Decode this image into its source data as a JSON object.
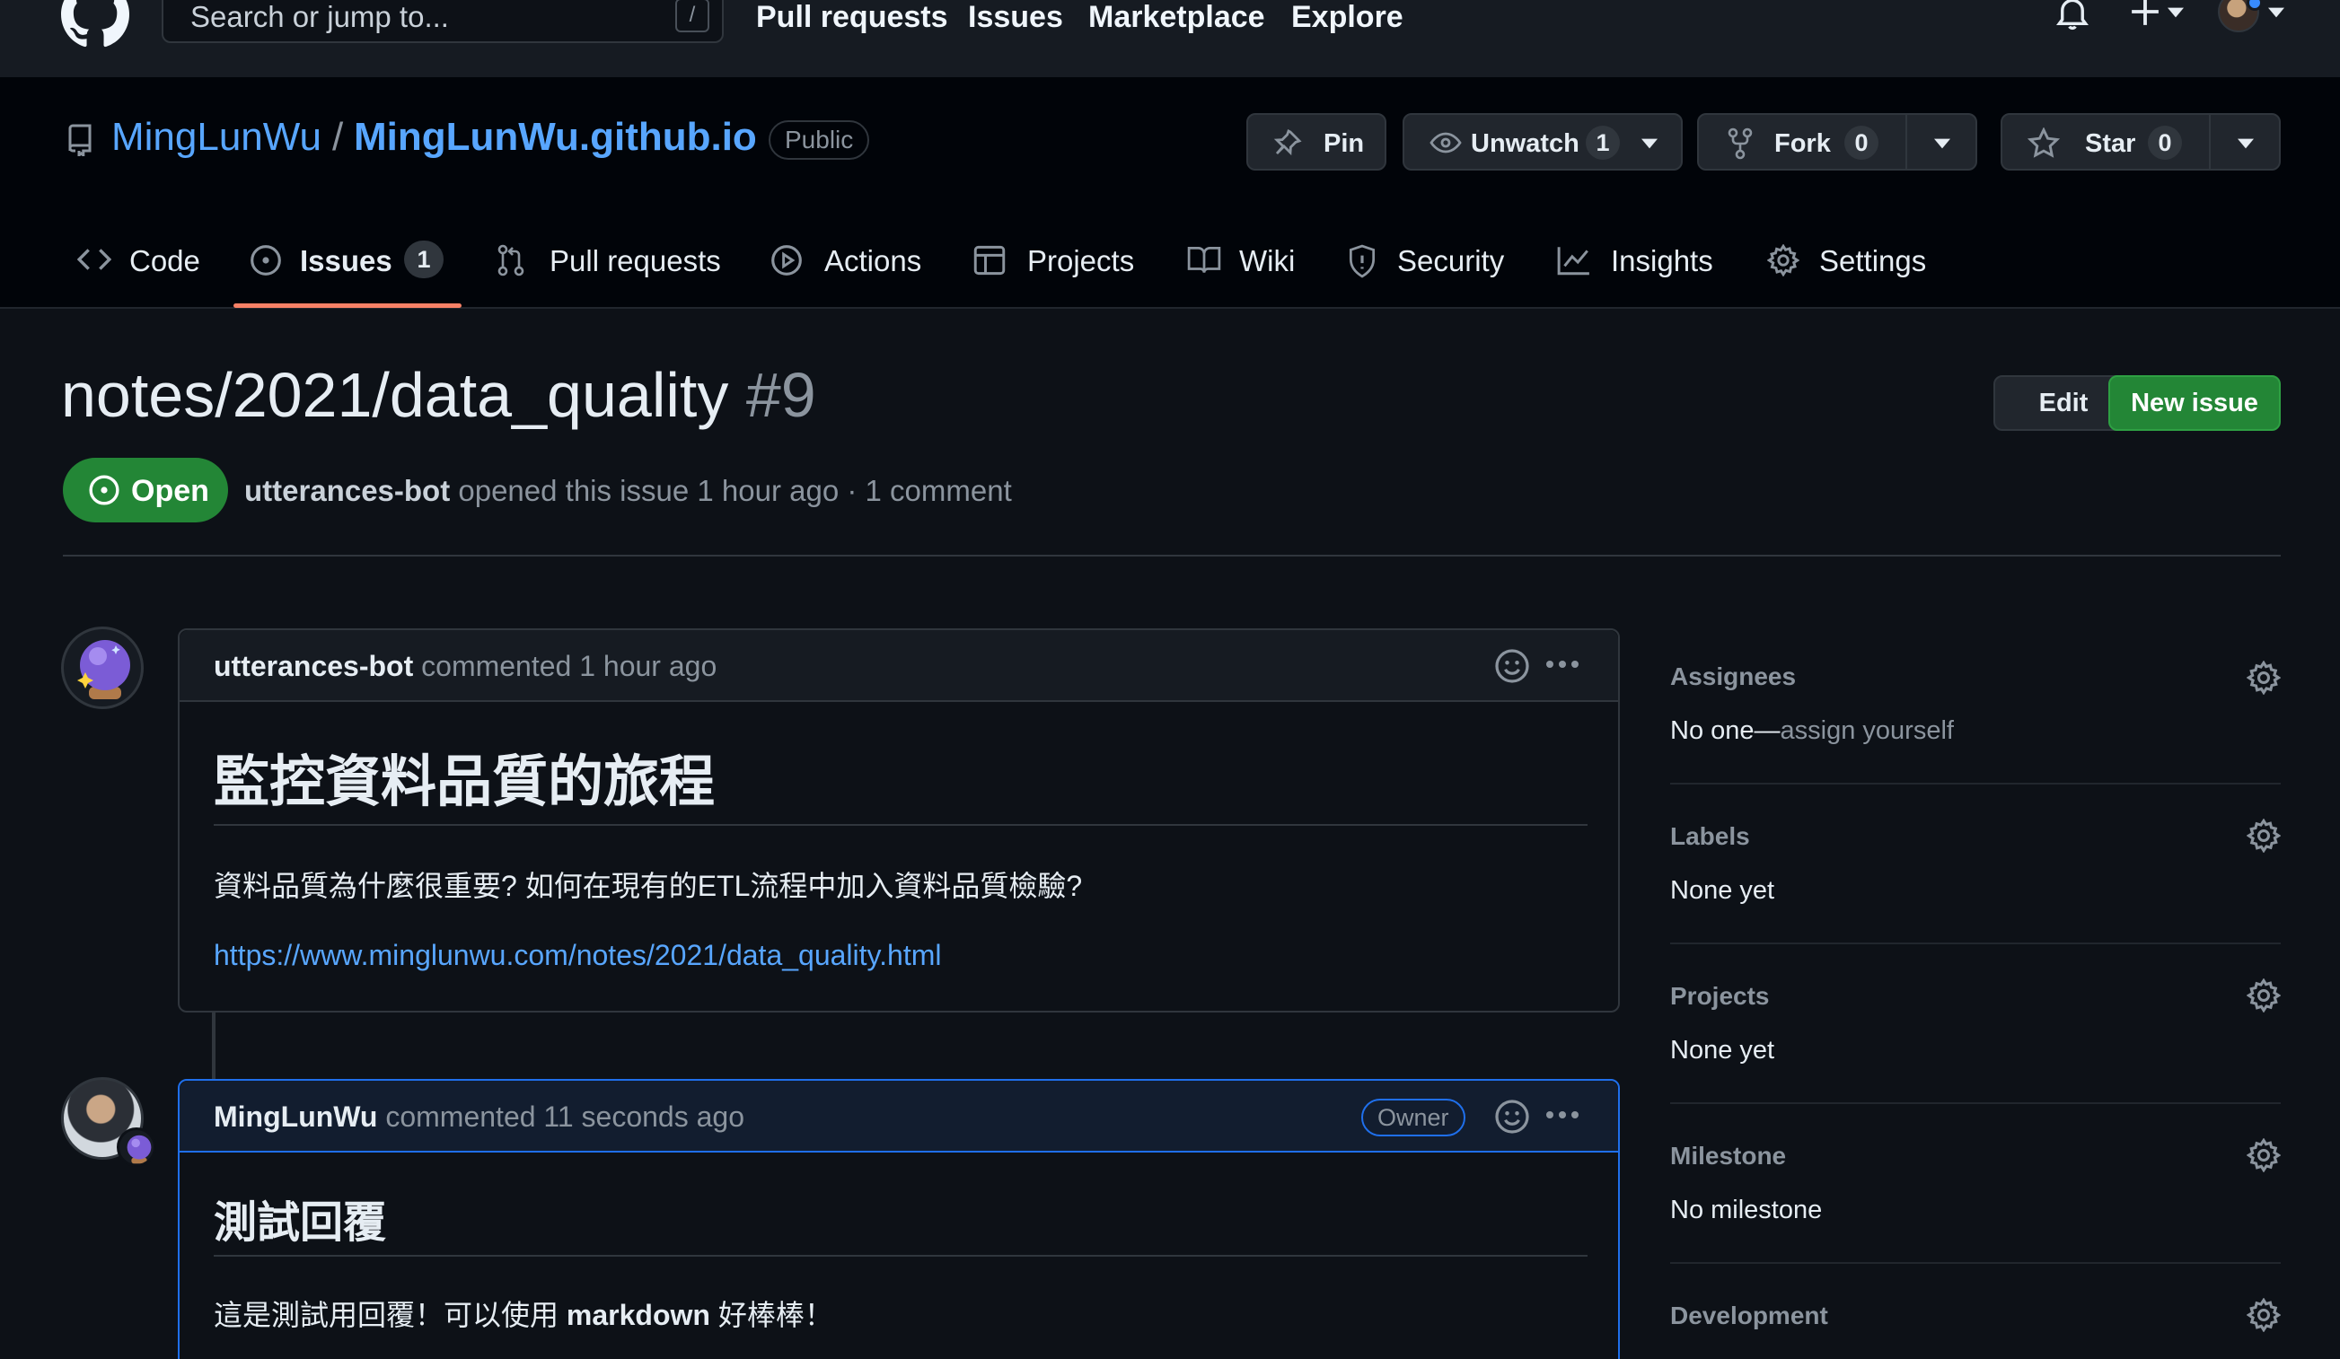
{
  "header": {
    "search_placeholder": "Search or jump to...",
    "search_kbd": "/",
    "nav": [
      "Pull requests",
      "Issues",
      "Marketplace",
      "Explore"
    ]
  },
  "repo": {
    "owner": "MingLunWu",
    "slash": "/",
    "name": "MingLunWu.github.io",
    "visibility": "Public",
    "pin_label": "Pin",
    "unwatch_label": "Unwatch",
    "watch_count": "1",
    "fork_label": "Fork",
    "fork_count": "0",
    "star_label": "Star",
    "star_count": "0"
  },
  "tabs": [
    {
      "label": "Code",
      "icon": "code-icon"
    },
    {
      "label": "Issues",
      "icon": "issue-opened-icon",
      "count": "1",
      "selected": true
    },
    {
      "label": "Pull requests",
      "icon": "git-pull-request-icon"
    },
    {
      "label": "Actions",
      "icon": "play-icon"
    },
    {
      "label": "Projects",
      "icon": "table-icon"
    },
    {
      "label": "Wiki",
      "icon": "book-icon"
    },
    {
      "label": "Security",
      "icon": "shield-icon"
    },
    {
      "label": "Insights",
      "icon": "graph-icon"
    },
    {
      "label": "Settings",
      "icon": "gear-icon"
    }
  ],
  "issue": {
    "title": "notes/2021/data_quality",
    "number": "#9",
    "edit_label": "Edit",
    "new_issue_label": "New issue",
    "state": "Open",
    "author": "utterances-bot",
    "meta": "opened this issue 1 hour ago · 1 comment"
  },
  "comments": [
    {
      "author": "utterances-bot",
      "action": "commented 1 hour ago",
      "heading": "監控資料品質的旅程",
      "paragraph": "資料品質為什麼很重要? 如何在現有的ETL流程中加入資料品質檢驗?",
      "link": "https://www.minglunwu.com/notes/2021/data_quality.html"
    },
    {
      "author": "MingLunWu",
      "action": "commented 11 seconds ago",
      "badge": "Owner",
      "heading": "測試回覆",
      "text_before": "這是測試用回覆！可以使用 ",
      "text_bold": "markdown",
      "text_after": " 好棒棒！"
    }
  ],
  "sidebar": {
    "assignees_title": "Assignees",
    "assignees_value_prefix": "No one—",
    "assignees_value_link": "assign yourself",
    "labels_title": "Labels",
    "labels_value": "None yet",
    "projects_title": "Projects",
    "projects_value": "None yet",
    "milestone_title": "Milestone",
    "milestone_value": "No milestone",
    "development_title": "Development"
  },
  "colors": {
    "accent_link": "#58a6ff",
    "open_green": "#238636",
    "selected_tab_underline": "#f78166",
    "background": "#0d1117"
  }
}
